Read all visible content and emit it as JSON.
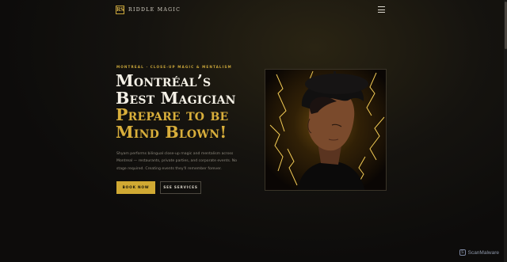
{
  "header": {
    "logo_mark": "RS",
    "logo_text": "RIDDLE MAGIC"
  },
  "hero": {
    "eyebrow": "MONTREAL · CLOSE-UP MAGIC & MENTALISM",
    "headline_white_1": "Montréal’s",
    "headline_white_2": "Best Magician",
    "headline_gold_1": "Prepare to be",
    "headline_gold_2": "Mind Blown!",
    "description": "Shyam performs bilingual close-up magic and mentalism across Montreal — restaurants, private parties, and corporate events. No stage required. Creating events they'll remember forever.",
    "book_label": "BOOK NOW",
    "services_label": "SEE SERVICES"
  },
  "watermark": {
    "text": "ScanMalware"
  },
  "colors": {
    "accent_gold": "#d0a933",
    "background": "#0d0c0b",
    "text_light": "#f4f0e6"
  },
  "icons": {
    "menu": "hamburger-menu-icon",
    "logo": "monogram-logo-icon",
    "watermark": "scanmalware-logo-icon"
  }
}
